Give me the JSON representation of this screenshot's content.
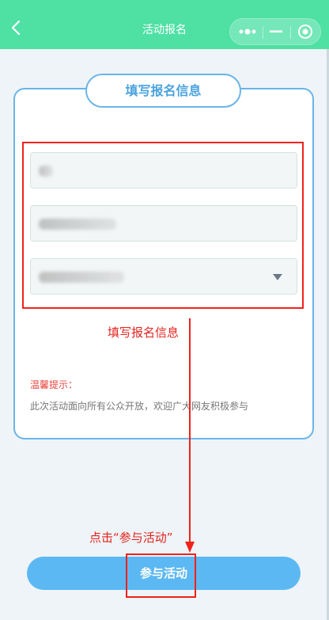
{
  "navbar": {
    "title": "活动报名",
    "back_icon": "chevron-left-icon",
    "more_icon": "more-dots-icon",
    "minimize_icon": "minimize-icon",
    "close_icon": "target-close-icon",
    "color": "#4fe0a4"
  },
  "form": {
    "section_title": "填写报名信息",
    "fields": [
      {
        "value": ""
      },
      {
        "value": ""
      },
      {
        "value": "",
        "type": "select"
      }
    ],
    "tip_title": "温馨提示：",
    "tip_text": "此次活动面向所有公众开放，欢迎广大网友积极参与"
  },
  "annotations": {
    "fill_info": "填写报名信息",
    "click_join": "点击“参与活动”",
    "color": "#f0221b"
  },
  "actions": {
    "join_label": "参与活动",
    "button_color": "#5cb8f2"
  }
}
